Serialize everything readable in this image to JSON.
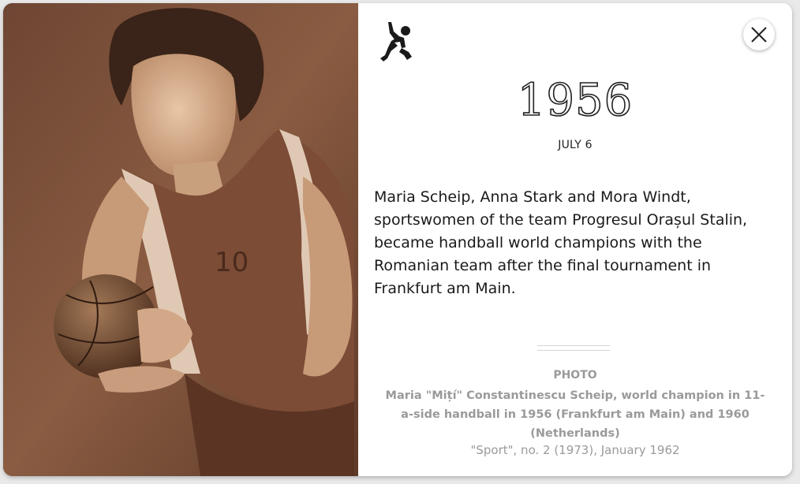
{
  "event": {
    "year": "1956",
    "date": "JULY 6",
    "description": "Maria Scheip, Anna Stark and Mora Windt, sportswomen of the team Progresul Orașul Stalin, became handball world champions with the Romanian team after the final tournament in Frankfurt am Main."
  },
  "photo": {
    "label": "PHOTO",
    "caption": "Maria \"Mițí\" Constantinescu Scheip, world champion in 11-a-side handball in 1956 (Frankfurt am Main) and 1960 (Netherlands)",
    "source": "\"Sport\", no. 2 (1973), January 1962",
    "jersey_number": "10",
    "tone_color": "#7a5038"
  },
  "icons": {
    "sport": "handball-player-icon",
    "close": "close-icon"
  }
}
